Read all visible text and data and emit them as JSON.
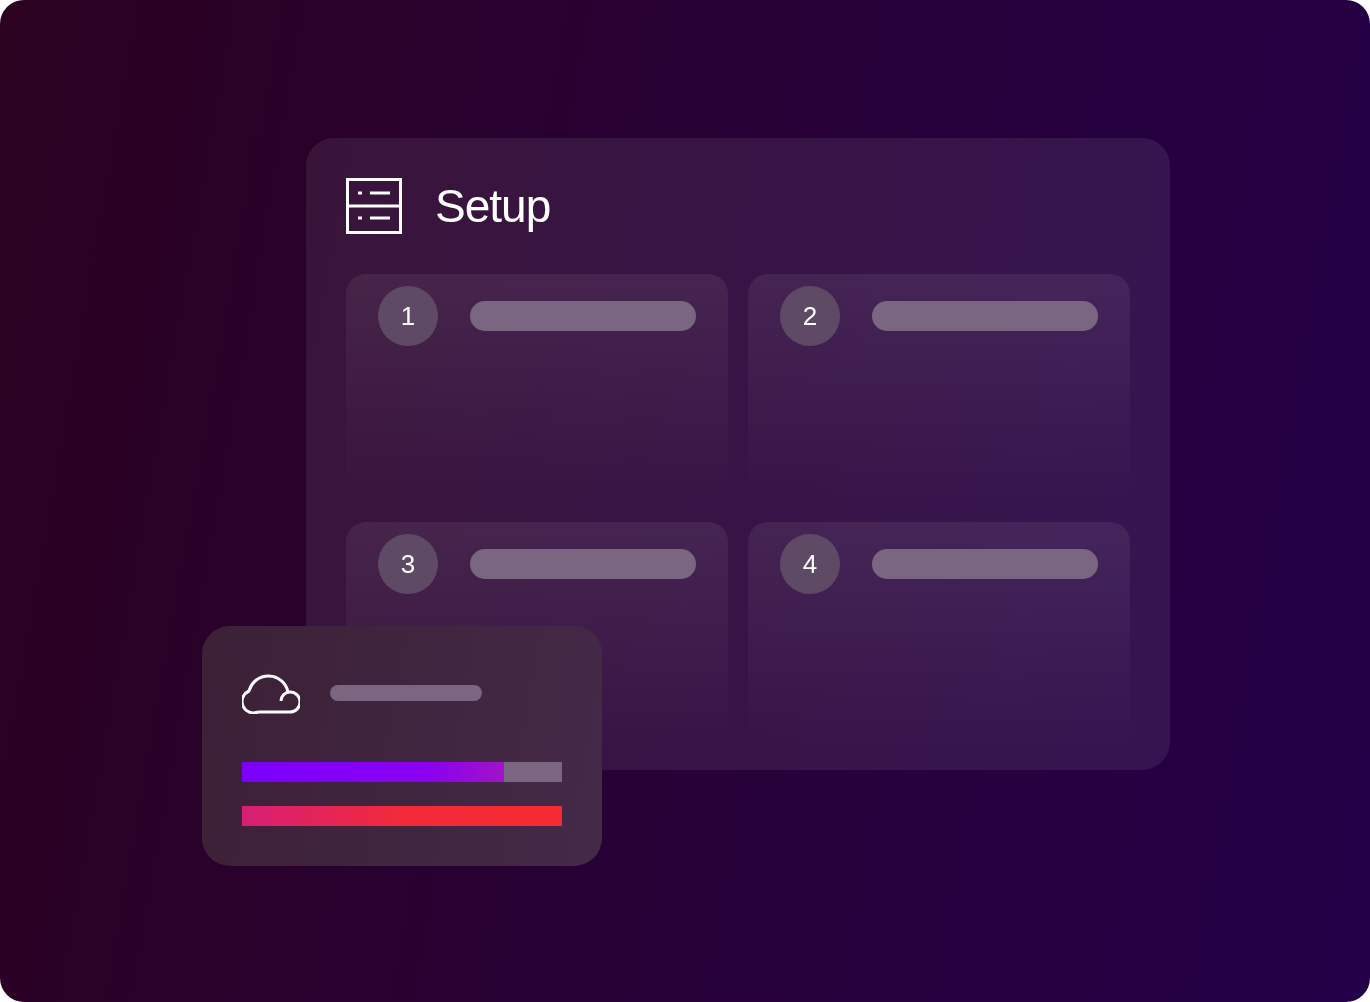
{
  "panel": {
    "title": "Setup"
  },
  "steps": [
    {
      "number": "1"
    },
    {
      "number": "2"
    },
    {
      "number": "3"
    },
    {
      "number": "4"
    }
  ],
  "status_card": {
    "bars": [
      {
        "level": 0.82,
        "kind": "primary"
      },
      {
        "kind": "alert"
      }
    ]
  }
}
